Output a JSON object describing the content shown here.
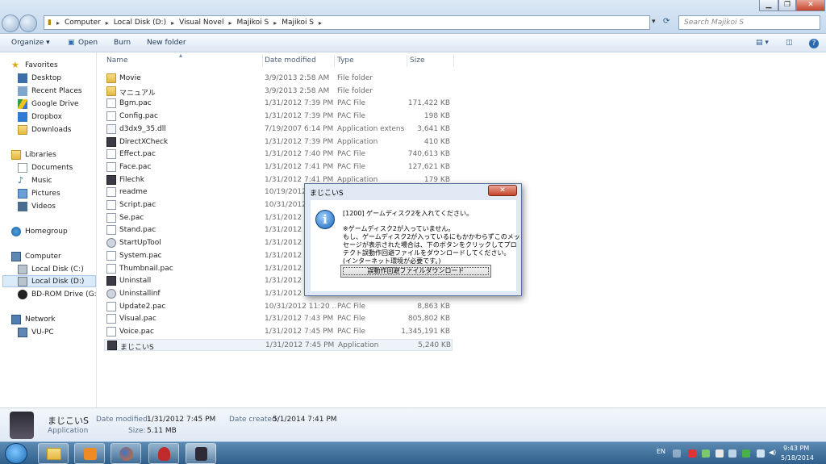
{
  "window": {
    "breadcrumb": [
      "Computer",
      "Local Disk (D:)",
      "Visual Novel",
      "Majikoi S",
      "Majikoi S"
    ],
    "search_placeholder": "Search Majikoi S"
  },
  "toolbar": {
    "organize": "Organize ▾",
    "open": "Open",
    "burn": "Burn",
    "new_folder": "New folder"
  },
  "nav": {
    "favorites": "Favorites",
    "fav_items": [
      "Desktop",
      "Recent Places",
      "Google Drive",
      "Dropbox",
      "Downloads"
    ],
    "libraries": "Libraries",
    "lib_items": [
      "Documents",
      "Music",
      "Pictures",
      "Videos"
    ],
    "homegroup": "Homegroup",
    "computer": "Computer",
    "comp_items": [
      "Local Disk (C:)",
      "Local Disk (D:)",
      "BD-ROM Drive (G:) V"
    ],
    "network": "Network",
    "net_items": [
      "VU-PC"
    ]
  },
  "columns": {
    "name": "Name",
    "date": "Date modified",
    "type": "Type",
    "size": "Size"
  },
  "files": [
    {
      "name": "Movie",
      "date": "3/9/2013 2:58 AM",
      "type": "File folder",
      "size": "",
      "icon": "folder"
    },
    {
      "name": "マニュアル",
      "date": "3/9/2013 2:58 AM",
      "type": "File folder",
      "size": "",
      "icon": "folder"
    },
    {
      "name": "Bgm.pac",
      "date": "1/31/2012 7:39 PM",
      "type": "PAC File",
      "size": "171,422 KB",
      "icon": "doc"
    },
    {
      "name": "Config.pac",
      "date": "1/31/2012 7:39 PM",
      "type": "PAC File",
      "size": "198 KB",
      "icon": "doc"
    },
    {
      "name": "d3dx9_35.dll",
      "date": "7/19/2007 6:14 PM",
      "type": "Application extens...",
      "size": "3,641 KB",
      "icon": "dll"
    },
    {
      "name": "DirectXCheck",
      "date": "1/31/2012 7:39 PM",
      "type": "Application",
      "size": "410 KB",
      "icon": "app"
    },
    {
      "name": "Effect.pac",
      "date": "1/31/2012 7:40 PM",
      "type": "PAC File",
      "size": "740,613 KB",
      "icon": "doc"
    },
    {
      "name": "Face.pac",
      "date": "1/31/2012 7:41 PM",
      "type": "PAC File",
      "size": "127,621 KB",
      "icon": "doc"
    },
    {
      "name": "Filechk",
      "date": "1/31/2012 7:41 PM",
      "type": "Application",
      "size": "179 KB",
      "icon": "app"
    },
    {
      "name": "readme",
      "date": "10/19/2012 5:",
      "type": "",
      "size": "",
      "icon": "doc"
    },
    {
      "name": "Script.pac",
      "date": "10/31/2012 11:",
      "type": "",
      "size": "",
      "icon": "doc"
    },
    {
      "name": "Se.pac",
      "date": "1/31/2012 7:",
      "type": "",
      "size": "",
      "icon": "doc"
    },
    {
      "name": "Stand.pac",
      "date": "1/31/2012 7:",
      "type": "",
      "size": "",
      "icon": "doc"
    },
    {
      "name": "StartUpTool",
      "date": "1/31/2012 7:",
      "type": "",
      "size": "",
      "icon": "gear"
    },
    {
      "name": "System.pac",
      "date": "1/31/2012 7:",
      "type": "",
      "size": "",
      "icon": "doc"
    },
    {
      "name": "Thumbnail.pac",
      "date": "1/31/2012 7:",
      "type": "",
      "size": "",
      "icon": "doc"
    },
    {
      "name": "Uninstall",
      "date": "1/31/2012 7:",
      "type": "",
      "size": "",
      "icon": "app"
    },
    {
      "name": "Uninstallinf",
      "date": "1/31/2012 7:",
      "type": "",
      "size": "",
      "icon": "gear"
    },
    {
      "name": "Update2.pac",
      "date": "10/31/2012 11:20 ...",
      "type": "PAC File",
      "size": "8,863 KB",
      "icon": "doc"
    },
    {
      "name": "Visual.pac",
      "date": "1/31/2012 7:43 PM",
      "type": "PAC File",
      "size": "805,802 KB",
      "icon": "doc"
    },
    {
      "name": "Voice.pac",
      "date": "1/31/2012 7:45 PM",
      "type": "PAC File",
      "size": "1,345,191 KB",
      "icon": "doc"
    },
    {
      "name": "まじこいS",
      "date": "1/31/2012 7:45 PM",
      "type": "Application",
      "size": "5,240 KB",
      "icon": "app"
    }
  ],
  "details": {
    "name": "まじこいS",
    "kind": "Application",
    "modified_label": "Date modified:",
    "modified_value": "1/31/2012 7:45 PM",
    "created_label": "Date created:",
    "created_value": "5/1/2014 7:41 PM",
    "size_label": "Size:",
    "size_value": "5.11 MB"
  },
  "dialog": {
    "title": "まじこいS",
    "close": "✕",
    "icon": "i",
    "line1": "[1200] ゲームディスク2を入れてください。",
    "line2": "※ゲームディスク2が入っていません。",
    "line3": "もし、ゲームディスク2が入っているにもかかわらずこのメッ",
    "line4": "セージが表示された場合は、下のボタンをクリックしてプロ",
    "line5": "テクト誤動作回避ファイルをダウンロードしてください。",
    "line6": "(インターネット環境が必要です。)",
    "button": "誤動作回避ファイルダウンロード"
  },
  "taskbar": {
    "lang": "EN",
    "time": "9:43 PM",
    "date": "5/18/2014"
  }
}
